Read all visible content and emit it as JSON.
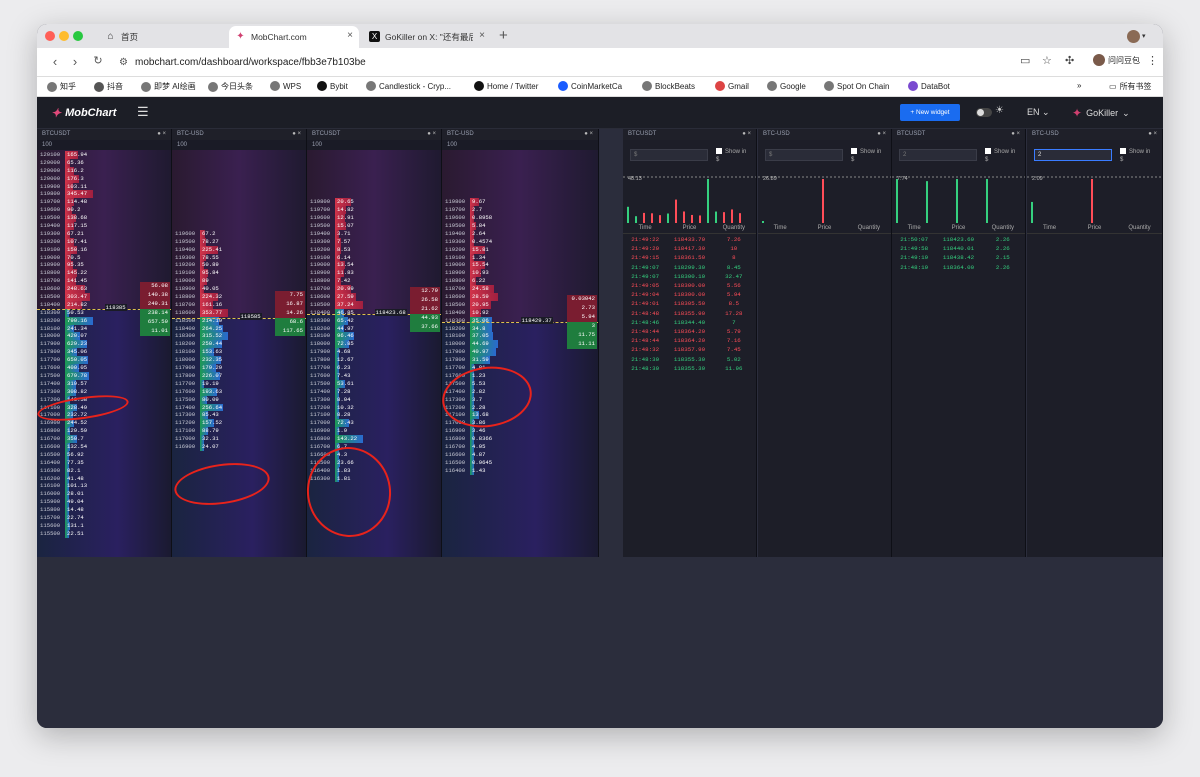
{
  "browser": {
    "tabs": [
      {
        "icon": "home-icon",
        "label": "首页"
      },
      {
        "icon": "mobchart-icon",
        "label": "MobChart.com",
        "active": true
      },
      {
        "icon": "x-icon",
        "label": "GoKiller on X: \"还有最后"
      }
    ],
    "url": "mobchart.com/dashboard/workspace/fbb3e7b103be",
    "user": "问问豆包",
    "bookmarks": [
      "知乎",
      "抖音",
      "即梦 AI绘画",
      "今日头条",
      "WPS",
      "Bybit",
      "Candlestick - Cryp...",
      "Home / Twitter",
      "CoinMarketCa",
      "BlockBeats",
      "Gmail",
      "Google",
      "Spot On Chain",
      "DataBot"
    ],
    "bookmarks_folder": "所有书签"
  },
  "app": {
    "logo": "MobChart",
    "new_widget": "New widget",
    "lang": "EN",
    "account": "GoKiller"
  },
  "orderbooks": [
    {
      "symbol": "BTCUSDT",
      "step": "100",
      "mid_price": "118385",
      "asks": [
        [
          "120100",
          "165.94"
        ],
        [
          "120000",
          "65.36"
        ],
        [
          "120000",
          "116.2"
        ],
        [
          "120000",
          "176.3"
        ],
        [
          "119900",
          "103.11"
        ],
        [
          "119800",
          "345.47"
        ],
        [
          "119700",
          "114.48"
        ],
        [
          "119600",
          "90.2"
        ],
        [
          "119500",
          "138.68"
        ],
        [
          "119400",
          "117.15"
        ],
        [
          "119300",
          "67.21"
        ],
        [
          "119200",
          "107.41"
        ],
        [
          "119100",
          "150.16"
        ],
        [
          "119000",
          "70.5"
        ],
        [
          "118900",
          "95.35"
        ],
        [
          "118800",
          "145.22"
        ],
        [
          "118700",
          "141.45"
        ],
        [
          "118600",
          "248.63"
        ],
        [
          "118500",
          "303.47"
        ],
        [
          "118400",
          "214.82"
        ]
      ],
      "bids": [
        [
          "118300",
          "50.53"
        ],
        [
          "118200",
          "790.16"
        ],
        [
          "118100",
          "241.34"
        ],
        [
          "118000",
          "420.07"
        ],
        [
          "117900",
          "629.23"
        ],
        [
          "117800",
          "345.06"
        ],
        [
          "117700",
          "650.05"
        ],
        [
          "117600",
          "400.05"
        ],
        [
          "117500",
          "679.78"
        ],
        [
          "117400",
          "319.57"
        ],
        [
          "117300",
          "308.82"
        ],
        [
          "117200",
          "140.58"
        ],
        [
          "117100",
          "328.49"
        ],
        [
          "117000",
          "232.72"
        ],
        [
          "116900",
          "244.52"
        ],
        [
          "116800",
          "129.59"
        ],
        [
          "116700",
          "350.7"
        ],
        [
          "116600",
          "132.54"
        ],
        [
          "116500",
          "56.92"
        ],
        [
          "116400",
          "77.35"
        ],
        [
          "116300",
          "82.1"
        ],
        [
          "116200",
          "41.48"
        ],
        [
          "116100",
          "101.13"
        ],
        [
          "116000",
          "28.01"
        ],
        [
          "115900",
          "49.04"
        ],
        [
          "115800",
          "14.48"
        ],
        [
          "115700",
          "22.74"
        ],
        [
          "115600",
          "131.1"
        ],
        [
          "115500",
          "22.51"
        ]
      ],
      "ladder": [
        "56.08",
        "140.38",
        "249.31",
        "238.14",
        "657.59",
        "11.01"
      ]
    },
    {
      "symbol": "BTC-USD",
      "step": "100",
      "mid_price": "118585",
      "asks": [
        [
          "119600",
          "67.2"
        ],
        [
          "119500",
          "78.27"
        ],
        [
          "119400",
          "225.41"
        ],
        [
          "119300",
          "78.55"
        ],
        [
          "119200",
          "50.89"
        ],
        [
          "119100",
          "95.84"
        ],
        [
          "119000",
          "89"
        ],
        [
          "118900",
          "40.05"
        ],
        [
          "118800",
          "224.32"
        ],
        [
          "118700",
          "161.16"
        ],
        [
          "118600",
          "353.77"
        ]
      ],
      "bids": [
        [
          "118500",
          "214.19"
        ],
        [
          "118400",
          "264.25"
        ],
        [
          "118300",
          "315.52"
        ],
        [
          "118200",
          "250.44"
        ],
        [
          "118100",
          "153.63"
        ],
        [
          "118000",
          "232.35"
        ],
        [
          "117900",
          "179.29"
        ],
        [
          "117800",
          "226.07"
        ],
        [
          "117700",
          "19.19"
        ],
        [
          "117600",
          "193.63"
        ],
        [
          "117500",
          "80.09"
        ],
        [
          "117400",
          "256.64"
        ],
        [
          "117300",
          "85.43"
        ],
        [
          "117200",
          "157.52"
        ],
        [
          "117100",
          "88.79"
        ],
        [
          "117000",
          "32.31"
        ],
        [
          "116900",
          "24.07"
        ]
      ],
      "ladder": [
        "7.75",
        "16.87",
        "14.26",
        "68.6",
        "117.65"
      ]
    },
    {
      "symbol": "BTCUSDT",
      "step": "100",
      "mid_price": "118423.68",
      "asks": [
        [
          "119800",
          "20.65"
        ],
        [
          "119700",
          "14.82"
        ],
        [
          "119600",
          "12.91"
        ],
        [
          "119500",
          "15.07"
        ],
        [
          "119400",
          "3.71"
        ],
        [
          "119300",
          "7.57"
        ],
        [
          "119200",
          "8.53"
        ],
        [
          "119100",
          "6.14"
        ],
        [
          "119000",
          "13.54"
        ],
        [
          "118900",
          "11.83"
        ],
        [
          "118800",
          "7.42"
        ],
        [
          "118700",
          "20.99"
        ],
        [
          "118600",
          "27.59"
        ],
        [
          "118500",
          "37.24"
        ]
      ],
      "bids": [
        [
          "118400",
          "46.85"
        ],
        [
          "118300",
          "65.42"
        ],
        [
          "118200",
          "44.97"
        ],
        [
          "118100",
          "96.46"
        ],
        [
          "118000",
          "72.85"
        ],
        [
          "117900",
          "4.68"
        ],
        [
          "117800",
          "12.67"
        ],
        [
          "117700",
          "6.23"
        ],
        [
          "117600",
          "7.43"
        ],
        [
          "117500",
          "53.61"
        ],
        [
          "117400",
          "7.28"
        ],
        [
          "117300",
          "8.04"
        ],
        [
          "117200",
          "10.32"
        ],
        [
          "117100",
          "8.28"
        ],
        [
          "117000",
          "72.43"
        ],
        [
          "116900",
          "1.9"
        ],
        [
          "116800",
          "143.22"
        ],
        [
          "116700",
          "6.7"
        ],
        [
          "116600",
          "4.3"
        ],
        [
          "116500",
          "23.66"
        ],
        [
          "116400",
          "1.83"
        ],
        [
          "116300",
          "1.81"
        ]
      ],
      "ladder": [
        "12.79",
        "26.58",
        "21.62",
        "44.93",
        "37.66"
      ]
    },
    {
      "symbol": "BTC-USD",
      "step": "100",
      "mid_price": "118429.37",
      "asks": [
        [
          "119800",
          "9.67"
        ],
        [
          "119700",
          "2.7"
        ],
        [
          "119600",
          "0.8958"
        ],
        [
          "119500",
          "5.84"
        ],
        [
          "119400",
          "2.64"
        ],
        [
          "119300",
          "0.4574"
        ],
        [
          "119200",
          "15.81"
        ],
        [
          "119100",
          "1.34"
        ],
        [
          "119000",
          "15.54"
        ],
        [
          "118900",
          "10.93"
        ],
        [
          "118800",
          "6.22"
        ],
        [
          "118700",
          "24.58"
        ],
        [
          "118600",
          "28.59"
        ],
        [
          "118500",
          "20.95"
        ],
        [
          "118400",
          "10.92"
        ]
      ],
      "bids": [
        [
          "118300",
          "35.06"
        ],
        [
          "118200",
          "34.8"
        ],
        [
          "118100",
          "37.05"
        ],
        [
          "118000",
          "44.69"
        ],
        [
          "117900",
          "40.97"
        ],
        [
          "117800",
          "31.59"
        ],
        [
          "117700",
          "4.01"
        ],
        [
          "117600",
          "1.23"
        ],
        [
          "117500",
          "5.53"
        ],
        [
          "117400",
          "2.82"
        ],
        [
          "117300",
          "3.7"
        ],
        [
          "117200",
          "2.28"
        ],
        [
          "117100",
          "13.68"
        ],
        [
          "117000",
          "3.86"
        ],
        [
          "116900",
          "3.46"
        ],
        [
          "116800",
          "0.8366"
        ],
        [
          "116700",
          "4.05"
        ],
        [
          "116600",
          "4.87"
        ],
        [
          "116500",
          "0.9645"
        ],
        [
          "116400",
          "1.43"
        ]
      ],
      "ladder": [
        "0.03042",
        "2.73",
        "5.94",
        "3",
        "11.75",
        "11.11"
      ]
    }
  ],
  "trade_panels": [
    {
      "symbol": "BTCUSDT",
      "filter": "$",
      "show_label": "Show in $",
      "vol_label": "48.13",
      "columns": [
        "Time",
        "Price",
        "Quantity"
      ],
      "trades": [
        {
          "time": "21:49:22",
          "price": "118433.70",
          "qty": "7.26",
          "side": "sell"
        },
        {
          "time": "21:49:20",
          "price": "118417.30",
          "qty": "10",
          "side": "sell"
        },
        {
          "time": "21:49:15",
          "price": "118361.50",
          "qty": "8",
          "side": "sell"
        },
        {
          "time": "21:49:07",
          "price": "118299.30",
          "qty": "8.45",
          "side": "buy"
        },
        {
          "time": "21:49:07",
          "price": "118300.10",
          "qty": "32.47",
          "side": "buy"
        },
        {
          "time": "21:49:05",
          "price": "118300.00",
          "qty": "5.56",
          "side": "sell"
        },
        {
          "time": "21:49:04",
          "price": "118300.00",
          "qty": "5.94",
          "side": "sell"
        },
        {
          "time": "21:49:01",
          "price": "118305.50",
          "qty": "8.5",
          "side": "sell"
        },
        {
          "time": "21:48:48",
          "price": "118355.90",
          "qty": "17.28",
          "side": "sell"
        },
        {
          "time": "21:48:46",
          "price": "118344.40",
          "qty": "7",
          "side": "buy"
        },
        {
          "time": "21:48:44",
          "price": "118364.20",
          "qty": "5.79",
          "side": "sell"
        },
        {
          "time": "21:48:44",
          "price": "118364.20",
          "qty": "7.16",
          "side": "sell"
        },
        {
          "time": "21:48:32",
          "price": "118357.90",
          "qty": "7.45",
          "side": "sell"
        },
        {
          "time": "21:48:30",
          "price": "118355.30",
          "qty": "5.02",
          "side": "buy"
        },
        {
          "time": "21:48:30",
          "price": "118355.30",
          "qty": "11.96",
          "side": "buy"
        }
      ]
    },
    {
      "symbol": "BTC-USD",
      "filter": "$",
      "show_label": "Show in $",
      "vol_label": "26.89",
      "columns": [
        "Time",
        "Price",
        "Quantity"
      ],
      "trades": []
    },
    {
      "symbol": "BTCUSDT",
      "filter": "2",
      "show_label": "Show in $",
      "vol_label": "7.74",
      "columns": [
        "Time",
        "Price",
        "Quantity"
      ],
      "trades": [
        {
          "time": "21:50:07",
          "price": "118423.69",
          "qty": "2.26",
          "side": "buy"
        },
        {
          "time": "21:49:58",
          "price": "118440.01",
          "qty": "2.26",
          "side": "buy"
        },
        {
          "time": "21:49:19",
          "price": "118438.42",
          "qty": "2.15",
          "side": "buy"
        },
        {
          "time": "21:48:19",
          "price": "118364.00",
          "qty": "2.26",
          "side": "buy"
        }
      ]
    },
    {
      "symbol": "BTC-USD",
      "filter": "2",
      "show_label": "Show in $",
      "vol_label": "2.09",
      "columns": [
        "Time",
        "Price",
        "Quantity"
      ],
      "trades": []
    }
  ],
  "colors": {
    "ask": "#ff4d58",
    "bid": "#35d07f",
    "accent": "#1a6cf0",
    "annotation": "#e8231b"
  }
}
